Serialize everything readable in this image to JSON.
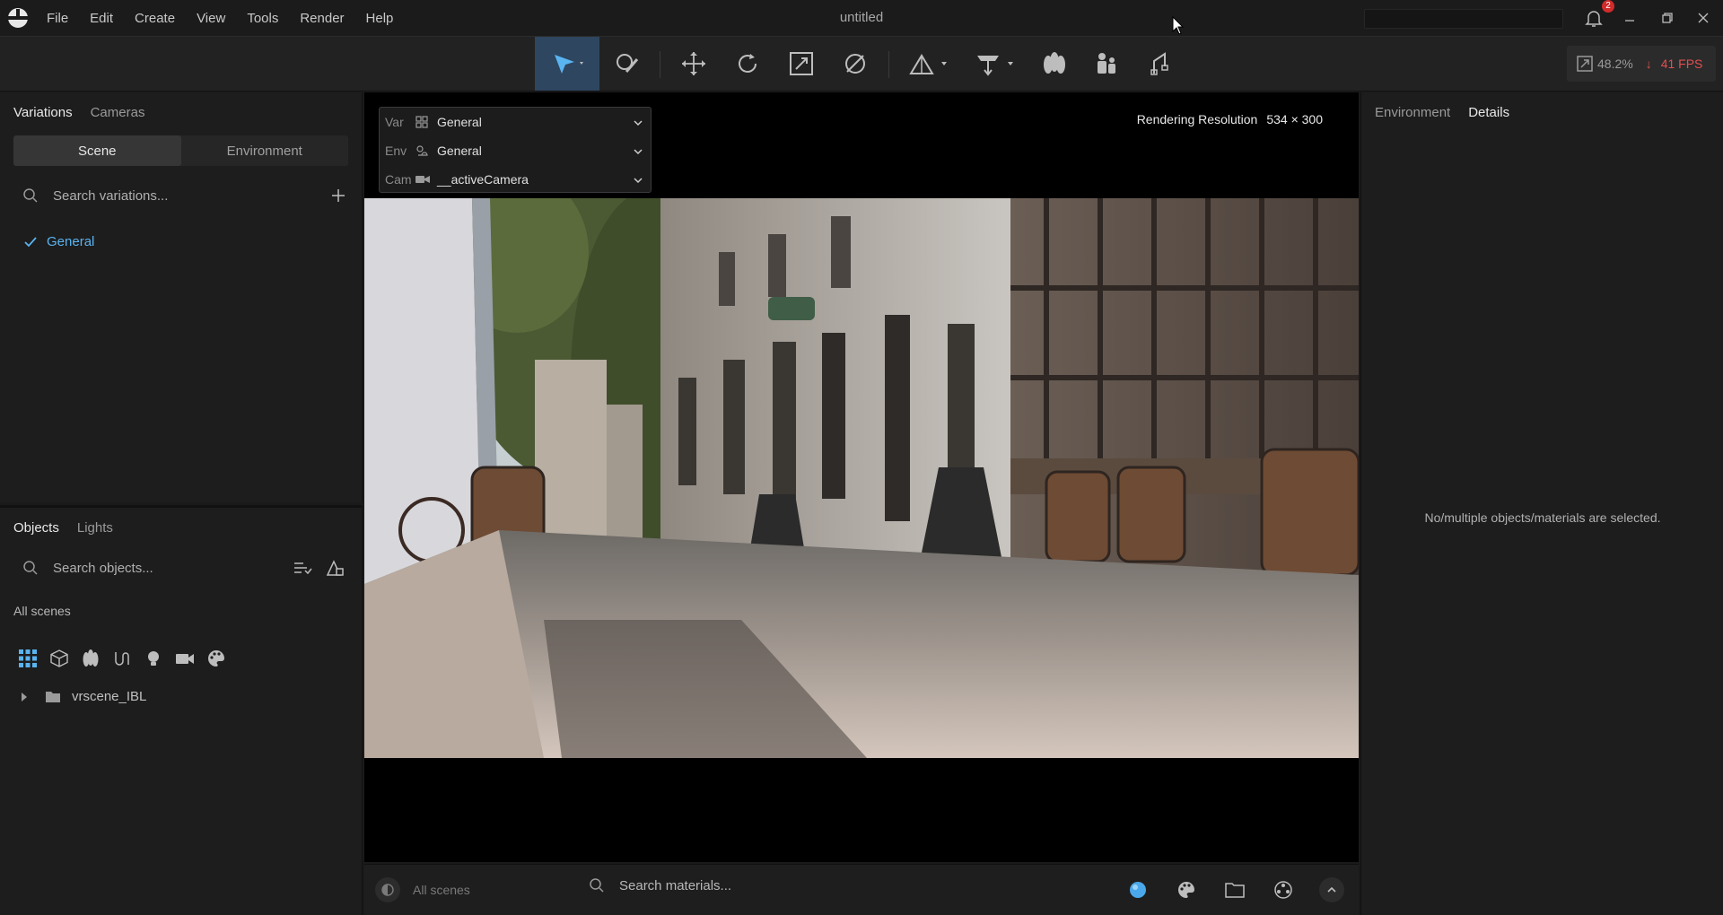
{
  "window": {
    "title": "untitled",
    "notifications": "2"
  },
  "menu": [
    "File",
    "Edit",
    "Create",
    "View",
    "Tools",
    "Render",
    "Help"
  ],
  "toolbar": {
    "zoom": "48.2%",
    "fps": "41 FPS"
  },
  "left_top": {
    "tabs": [
      "Variations",
      "Cameras"
    ],
    "segments": [
      "Scene",
      "Environment"
    ],
    "search_placeholder": "Search variations...",
    "items": [
      "General"
    ]
  },
  "left_bottom": {
    "tabs": [
      "Objects",
      "Lights"
    ],
    "search_placeholder": "Search objects...",
    "scenes_label": "All scenes",
    "tree": [
      "vrscene_IBL"
    ]
  },
  "viewport": {
    "selectors": [
      {
        "key": "Var",
        "value": "General"
      },
      {
        "key": "Env",
        "value": "General"
      },
      {
        "key": "Cam",
        "value": "__activeCamera"
      }
    ],
    "resolution_label": "Rendering Resolution",
    "resolution_value": "534 × 300"
  },
  "bottom_bar": {
    "scene_label": "All scenes",
    "material_placeholder": "Search materials..."
  },
  "right_panel": {
    "tabs": [
      "Environment",
      "Details"
    ],
    "empty_message": "No/multiple objects/materials are selected."
  }
}
